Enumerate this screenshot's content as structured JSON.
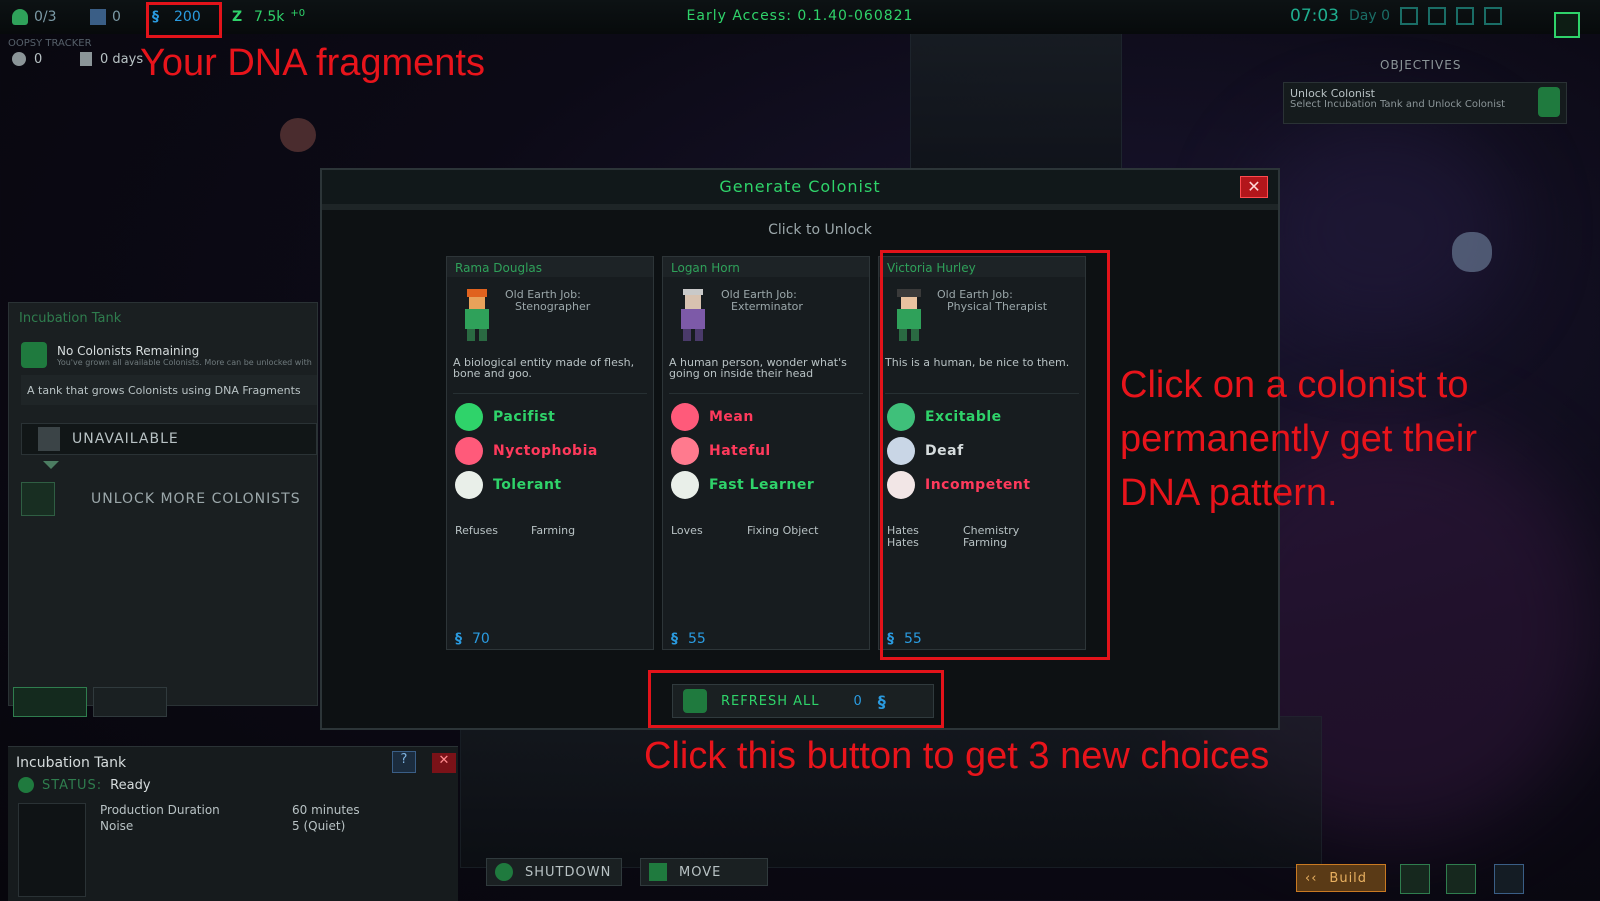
{
  "top": {
    "colonists": "0/3",
    "beds": "0",
    "dna": "200",
    "power": "7.5k",
    "power_delta": "+0",
    "version": "Early Access: 0.1.40-060821",
    "time": "07:03",
    "day": "Day 0"
  },
  "oopsy": {
    "title": "OOPSY TRACKER",
    "deaths": "0",
    "days": "0 days"
  },
  "objectives": {
    "header": "OBJECTIVES",
    "title": "Unlock Colonist",
    "desc": "Select Incubation Tank and Unlock Colonist"
  },
  "annotations": {
    "dna": "Your DNA fragments",
    "colonist": "Click on a colonist to permanently get their DNA pattern.",
    "refresh": "Click this button to get 3 new choices"
  },
  "left_panel": {
    "title": "Incubation Tank",
    "no_colonists": "No Colonists Remaining",
    "no_colonists_sub": "You've grown all available Colonists. More can be unlocked with",
    "desc": "A tank that grows Colonists using DNA Fragments",
    "unavailable": "UNAVAILABLE",
    "unlock_more": "UNLOCK MORE COLONISTS"
  },
  "modal": {
    "title": "Generate Colonist",
    "hint": "Click to Unlock",
    "refresh_label": "REFRESH ALL",
    "refresh_cost": "0",
    "cards": [
      {
        "name": "Rama Douglas",
        "job_label": "Old Earth Job:",
        "job": "Stenographer",
        "desc": "A biological entity made of flesh, bone and goo.",
        "traits": [
          {
            "label": "Pacifist",
            "tone": "green"
          },
          {
            "label": "Nyctophobia",
            "tone": "red"
          },
          {
            "label": "Tolerant",
            "tone": "green"
          }
        ],
        "prefs": [
          {
            "k": "Refuses",
            "v": "Farming"
          }
        ],
        "cost": "70"
      },
      {
        "name": "Logan Horn",
        "job_label": "Old Earth Job:",
        "job": "Exterminator",
        "desc": "A human person, wonder what's going on inside their head",
        "traits": [
          {
            "label": "Mean",
            "tone": "red"
          },
          {
            "label": "Hateful",
            "tone": "red"
          },
          {
            "label": "Fast Learner",
            "tone": "green"
          }
        ],
        "prefs": [
          {
            "k": "Loves",
            "v": "Fixing Object"
          }
        ],
        "cost": "55"
      },
      {
        "name": "Victoria Hurley",
        "job_label": "Old Earth Job:",
        "job": "Physical Therapist",
        "desc": "This is a human, be nice to them.",
        "traits": [
          {
            "label": "Excitable",
            "tone": "green"
          },
          {
            "label": "Deaf",
            "tone": "white"
          },
          {
            "label": "Incompetent",
            "tone": "red"
          }
        ],
        "prefs": [
          {
            "k": "Hates",
            "v": "Chemistry"
          },
          {
            "k": "Hates",
            "v": "Farming"
          }
        ],
        "cost": "55"
      }
    ]
  },
  "bottom_panel": {
    "title": "Incubation Tank",
    "status_label": "STATUS:",
    "status_value": "Ready",
    "rows": [
      {
        "k": "Production Duration",
        "v": "60 minutes"
      },
      {
        "k": "Noise",
        "v": "5 (Quiet)"
      }
    ]
  },
  "bottom_buttons": {
    "shutdown": "SHUTDOWN",
    "move": "MOVE",
    "build": "Build"
  }
}
